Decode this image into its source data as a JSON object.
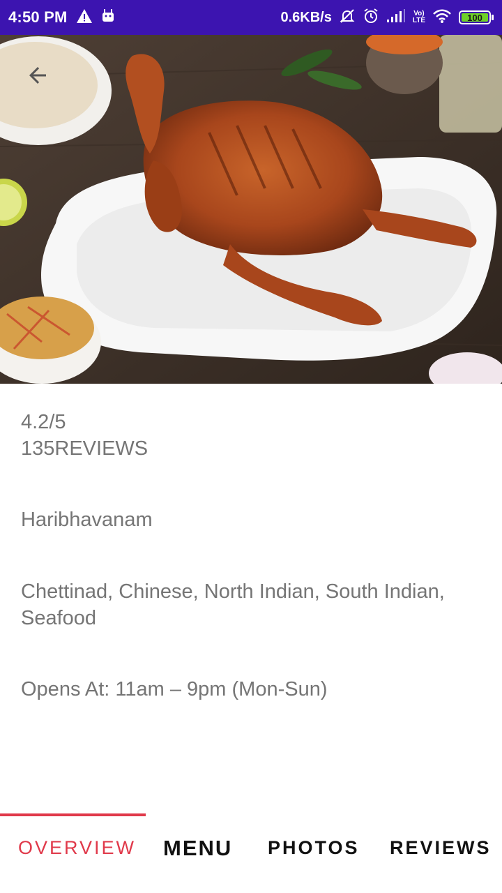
{
  "status_bar": {
    "time": "4:50 PM",
    "net_speed": "0.6KB/s",
    "network_label": "LTE",
    "battery_level": "100",
    "battery_color": "#6ed128",
    "background": "#3c14b0"
  },
  "hero": {
    "description_icon": "food-photo",
    "back_icon": "arrow-back-icon"
  },
  "restaurant": {
    "rating": "4.2/5",
    "reviews": "135REVIEWS",
    "name": "Haribhavanam",
    "cuisines": "Chettinad, Chinese, North Indian, South Indian, Seafood",
    "hours": "Opens At: 11am – 9pm (Mon-Sun)"
  },
  "tabs": {
    "items": [
      {
        "label": "OVERVIEW",
        "active": true
      },
      {
        "label": "MENU",
        "active": false
      },
      {
        "label": "PHOTOS",
        "active": false
      },
      {
        "label": "REVIEWS",
        "active": false
      }
    ],
    "accent_color": "#e0394a"
  }
}
